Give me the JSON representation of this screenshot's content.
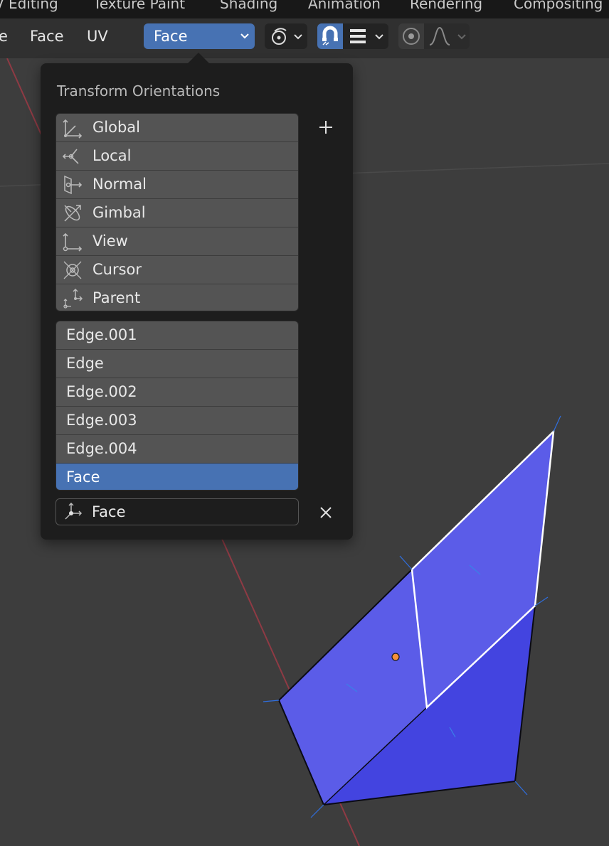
{
  "workspace_tabs": [
    "V Editing",
    "Texture Paint",
    "Shading",
    "Animation",
    "Rendering",
    "Compositing"
  ],
  "header_menu": [
    "e",
    "Face",
    "UV"
  ],
  "orientation_dropdown": {
    "value": "Face"
  },
  "popover": {
    "title": "Transform Orientations",
    "builtin_orientations": [
      {
        "label": "Global",
        "icon": "global-orientation-icon"
      },
      {
        "label": "Local",
        "icon": "local-orientation-icon"
      },
      {
        "label": "Normal",
        "icon": "normal-orientation-icon"
      },
      {
        "label": "Gimbal",
        "icon": "gimbal-orientation-icon"
      },
      {
        "label": "View",
        "icon": "view-orientation-icon"
      },
      {
        "label": "Cursor",
        "icon": "cursor-orientation-icon"
      },
      {
        "label": "Parent",
        "icon": "parent-orientation-icon"
      }
    ],
    "custom_orientations": [
      "Edge.001",
      "Edge",
      "Edge.002",
      "Edge.003",
      "Edge.004",
      "Face"
    ],
    "selected_custom": "Face",
    "name_field_value": "Face",
    "add_icon": "plus-icon",
    "delete_icon": "x-icon"
  },
  "colors": {
    "accent": "#4772b3",
    "mesh_face": "#5b5ce8",
    "mesh_face_dark": "#4344e0",
    "x_axis": "#8f3a44",
    "origin_dot": "#f5903a"
  }
}
